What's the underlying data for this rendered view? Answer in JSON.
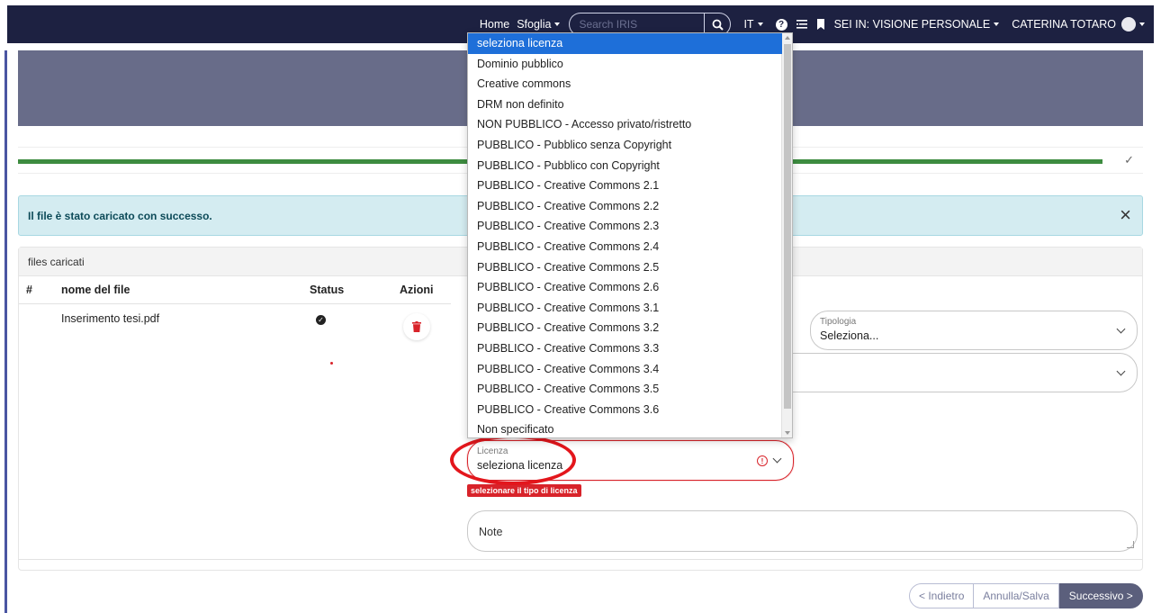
{
  "navbar": {
    "home": "Home",
    "browse": "Sfoglia",
    "search_placeholder": "Search IRIS",
    "language": "IT",
    "help_icon": "question-circle-icon",
    "list_icon": "list-icon",
    "bookmark_icon": "bookmark-icon",
    "workspace": "SEI IN: VISIONE PERSONALE",
    "user": "CATERINA TOTARO"
  },
  "progress": {
    "percent": 100,
    "status_icon": "check-icon"
  },
  "alert": {
    "message": "Il file è stato caricato con successo."
  },
  "files": {
    "title": "files caricati",
    "columns": [
      "#",
      "nome del file",
      "Status",
      "Azioni"
    ],
    "rows": [
      {
        "filename": "Inserimento tesi.pdf",
        "status_icon": "check-circle-icon",
        "action_icon": "trash-icon"
      }
    ]
  },
  "form": {
    "tipologia": {
      "label": "Tipologia",
      "value": "Seleziona..."
    },
    "licenza": {
      "label": "Licenza",
      "value": "seleziona licenza",
      "error": "selezionare il tipo di licenza"
    },
    "note": {
      "placeholder": "Note"
    }
  },
  "license_options": [
    "seleziona licenza",
    "Dominio pubblico",
    "Creative commons",
    "DRM non definito",
    "NON PUBBLICO - Accesso privato/ristretto",
    "PUBBLICO - Pubblico senza Copyright",
    "PUBBLICO - Pubblico con Copyright",
    "PUBBLICO - Creative Commons 2.1",
    "PUBBLICO - Creative Commons 2.2",
    "PUBBLICO - Creative Commons 2.3",
    "PUBBLICO - Creative Commons 2.4",
    "PUBBLICO - Creative Commons 2.5",
    "PUBBLICO - Creative Commons 2.6",
    "PUBBLICO - Creative Commons 3.1",
    "PUBBLICO - Creative Commons 3.2",
    "PUBBLICO - Creative Commons 3.3",
    "PUBBLICO - Creative Commons 3.4",
    "PUBBLICO - Creative Commons 3.5",
    "PUBBLICO - Creative Commons 3.6",
    "Non specificato"
  ],
  "license_selected": "seleziona licenza",
  "buttons": {
    "back": "< Indietro",
    "cancel": "Annulla/Salva",
    "next": "Successivo >"
  },
  "colors": {
    "navbar": "#1d2141",
    "header_band": "#686c89",
    "progress": "#3d8c40",
    "alert_bg": "#d4ecf1",
    "error": "#d8232a",
    "highlight": "#1e6fd9",
    "annotation": "#e3161c"
  }
}
